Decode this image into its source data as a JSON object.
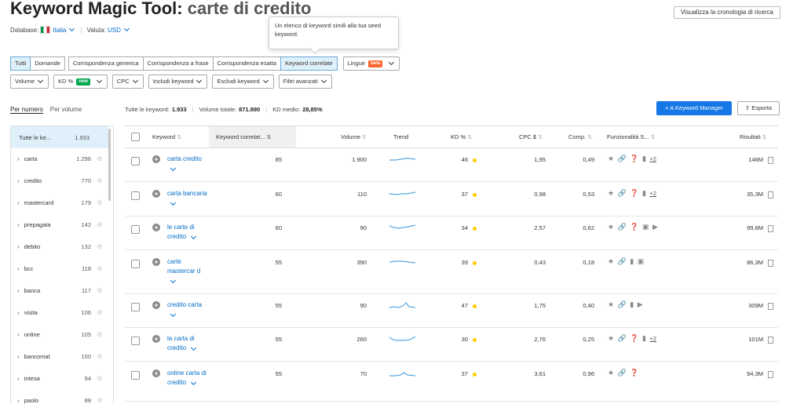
{
  "header": {
    "title_prefix": "Keyword Magic Tool:",
    "title_keyword": "carte di credito",
    "database_label": "Database:",
    "database_value": "Italia",
    "currency_label": "Valuta:",
    "currency_value": "USD",
    "history_button": "Visualizza la cronologia di ricerca"
  },
  "tooltip": {
    "text": "Un elenco di keyword simili alla tua seed keyword."
  },
  "match_tabs": [
    "Tutti",
    "Domande",
    "Corrispondenza generica",
    "Corrispondenza a frase",
    "Corrispondenza esatta",
    "Keyword correlate"
  ],
  "match_tab_selected": [
    true,
    false,
    false,
    false,
    false,
    true
  ],
  "lingue": {
    "label": "Lingue",
    "badge": "beta"
  },
  "filters": {
    "volume": "Volume",
    "kd": "KD %",
    "kd_badge": "new",
    "cpc": "CPC",
    "include": "Includi keyword",
    "exclude": "Escludi keyword",
    "advanced": "Filtri avanzati"
  },
  "sort_tabs": {
    "by_number": "Per numero",
    "by_volume": "Per volume"
  },
  "summary": {
    "all_label": "Tutte le keyword:",
    "all_value": "1.933",
    "volume_label": "Volume totale:",
    "volume_value": "871.890",
    "kd_label": "KD medio:",
    "kd_value": "28,85%"
  },
  "buttons": {
    "keyword_manager": "+ A Keyword Manager",
    "export": "Esporta"
  },
  "sidebar": [
    {
      "label": "Tutte le ke...",
      "count": "1.933"
    },
    {
      "label": "carta",
      "count": "1.296"
    },
    {
      "label": "credito",
      "count": "770"
    },
    {
      "label": "mastercard",
      "count": "179"
    },
    {
      "label": "prepagata",
      "count": "142"
    },
    {
      "label": "debito",
      "count": "132"
    },
    {
      "label": "bcc",
      "count": "118"
    },
    {
      "label": "banca",
      "count": "117"
    },
    {
      "label": "visita",
      "count": "106"
    },
    {
      "label": "online",
      "count": "105"
    },
    {
      "label": "bancomat",
      "count": "100"
    },
    {
      "label": "intesa",
      "count": "94"
    },
    {
      "label": "paolo",
      "count": "88"
    }
  ],
  "columns": {
    "keyword": "Keyword",
    "related": "Keyword correlat...",
    "volume": "Volume",
    "trend": "Trend",
    "kd": "KD %",
    "cpc": "CPC $",
    "comp": "Comp.",
    "features": "Funzionalità S...",
    "results": "Risultati"
  },
  "rows": [
    {
      "keyword": "carta credito",
      "related": "85",
      "volume": "1.900",
      "kd": "46",
      "cpc": "1,95",
      "comp": "0,49",
      "features": "★ 🔗 ❓ ▮",
      "more": "+2",
      "results": "146M"
    },
    {
      "keyword": "carta bancaria",
      "related": "60",
      "volume": "110",
      "kd": "37",
      "cpc": "0,98",
      "comp": "0,53",
      "features": "★ 🔗 ❓ ▮",
      "more": "+2",
      "results": "35,3M"
    },
    {
      "keyword": "le carte di credito",
      "related": "60",
      "volume": "90",
      "kd": "34",
      "cpc": "2,57",
      "comp": "0,62",
      "features": "★ 🔗 ❓ ▣ ▶",
      "more": "",
      "results": "99,6M"
    },
    {
      "keyword": "carte mastercar d",
      "related": "55",
      "volume": "390",
      "kd": "39",
      "cpc": "0,43",
      "comp": "0,18",
      "features": "★ 🔗 ▮ ▣",
      "more": "",
      "results": "86,3M"
    },
    {
      "keyword": "credito carta",
      "related": "55",
      "volume": "90",
      "kd": "47",
      "cpc": "1,75",
      "comp": "0,40",
      "features": "★ 🔗 ▮ ▶",
      "more": "",
      "results": "309M"
    },
    {
      "keyword": "la carta di credito",
      "related": "55",
      "volume": "260",
      "kd": "30",
      "cpc": "2,76",
      "comp": "0,25",
      "features": "★ 🔗 ❓ ▮",
      "more": "+2",
      "results": "101M"
    },
    {
      "keyword": "online carta di credito",
      "related": "55",
      "volume": "70",
      "kd": "37",
      "cpc": "3,61",
      "comp": "0,96",
      "features": "★ 🔗 ❓",
      "more": "",
      "results": "94,3M"
    }
  ]
}
